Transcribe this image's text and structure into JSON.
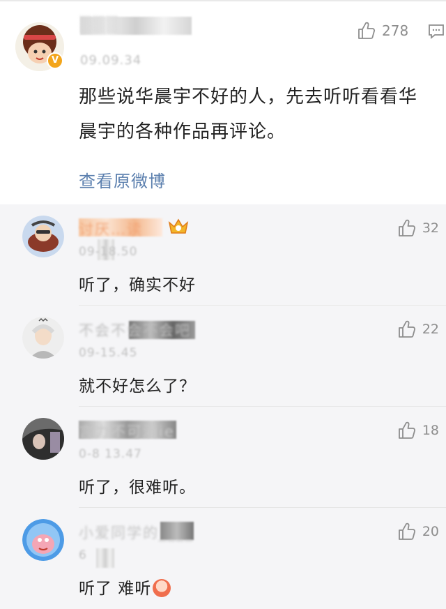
{
  "post": {
    "author_name": "▒▒▒",
    "time": "09.09.34",
    "likes": "278",
    "text": "那些说华晨宇不好的人，先去听听看看华晨宇的各种作品再评论。",
    "view_original": "查看原微博"
  },
  "replies": [
    {
      "author_name": "讨厌…读",
      "time": "09-18.50",
      "likes": "32",
      "text": "听了，确实不好"
    },
    {
      "author_name": "不会不会不会吧",
      "time": "09-15.45",
      "likes": "22",
      "text": "就不好怎么了？"
    },
    {
      "author_name": "言力不可酒ie",
      "time": "0-8 13.47",
      "likes": "18",
      "text": "听了，很难听。"
    },
    {
      "author_name": "小爱同学的____",
      "time": "6",
      "likes": "20",
      "text": "听了 难听"
    }
  ],
  "icons": {
    "like": "thumbs-up-icon",
    "comment": "comment-icon",
    "verified": "verified-badge-icon",
    "crown": "crown-icon"
  },
  "colors": {
    "link": "#5b7fae",
    "text": "#222222",
    "muted": "#8d8d8d",
    "badge": "#f3a51b"
  }
}
